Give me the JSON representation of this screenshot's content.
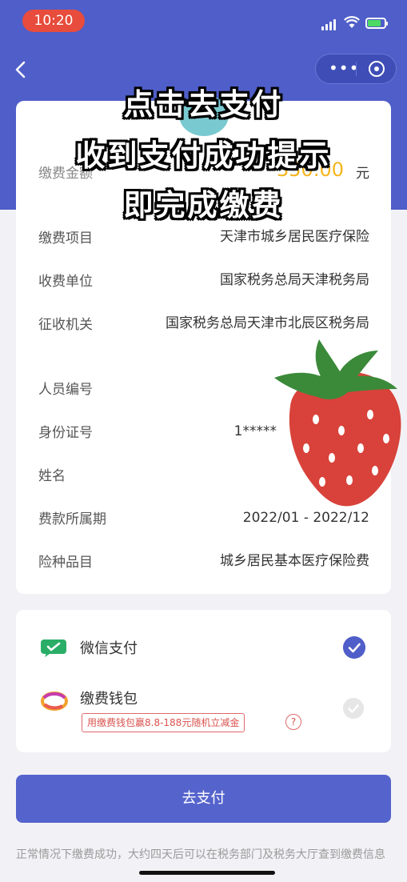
{
  "status_bar": {
    "time": "10:20"
  },
  "overlay_text": {
    "line1": "点击去支付",
    "line2": "收到支付成功提示",
    "line3": "即完成缴费"
  },
  "amount": {
    "label": "缴费金额",
    "value": "350.00",
    "unit": "元"
  },
  "details": [
    {
      "label": "缴费项目",
      "value": "天津市城乡居民医疗保险"
    },
    {
      "label": "收费单位",
      "value": "国家税务总局天津税务局"
    },
    {
      "label": "征收机关",
      "value": "国家税务总局天津市北辰区税务局"
    },
    {
      "label": "人员编号",
      "value": ""
    },
    {
      "label": "身份证号",
      "value": "1*****"
    },
    {
      "label": "姓名",
      "value": ""
    },
    {
      "label": "费款所属期",
      "value": "2022/01 - 2022/12"
    },
    {
      "label": "险种品目",
      "value": "城乡居民基本医疗保险费"
    }
  ],
  "payment": {
    "wechat_label": "微信支付",
    "wallet_label": "缴费钱包",
    "promo": "用缴费钱包赢8.8-188元随机立减金",
    "help": "?"
  },
  "pay_button": "去支付",
  "note": "正常情况下缴费成功，大约四天后可以在税务部门及税务大厅查到缴费信息",
  "colors": {
    "primary": "#4f5ec8",
    "amount": "#f5b51c",
    "wechat": "#2aae67",
    "promo": "#d9534f"
  }
}
